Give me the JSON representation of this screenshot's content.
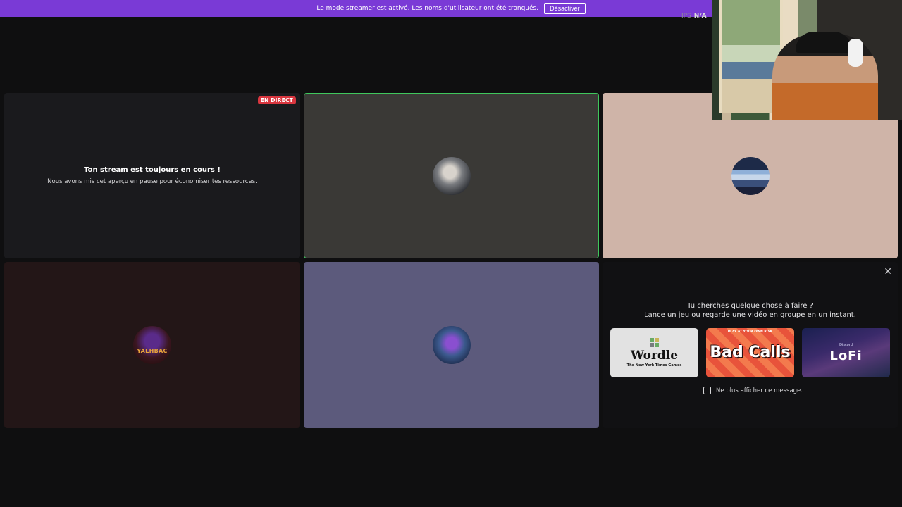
{
  "banner": {
    "text": "Le mode streamer est activé. Les noms d'utilisateur ont été tronqués.",
    "button_label": "Désactiver"
  },
  "fps": {
    "label": "IPS",
    "value": "N/A"
  },
  "stream_tile": {
    "live_badge": "EN DIRECT",
    "title": "Ton stream est toujours en cours !",
    "subtitle": "Nous avons mis cet aperçu en pause pour économiser tes ressources."
  },
  "participants": [
    {
      "avatar": "user-avatar-2"
    },
    {
      "avatar": "user-avatar-3"
    },
    {
      "avatar": "user-avatar-4",
      "text": "YALHBAC"
    },
    {
      "avatar": "user-avatar-5"
    }
  ],
  "activity": {
    "line1": "Tu cherches quelque chose à faire ?",
    "line2": "Lance un jeu ou regarde une vidéo en groupe en un instant.",
    "cards": [
      {
        "name": "Wordle",
        "sub": "The New York Times Games"
      },
      {
        "top": "PLAY AT YOUR OWN RISK",
        "name": "Bad Calls"
      },
      {
        "brand": "Discord",
        "name": "LoFi"
      }
    ],
    "checkbox_label": "Ne plus afficher ce message."
  },
  "colors": {
    "banner": "#7a3ad6",
    "speaking_border": "#3fc75c",
    "live": "#d9363f"
  }
}
